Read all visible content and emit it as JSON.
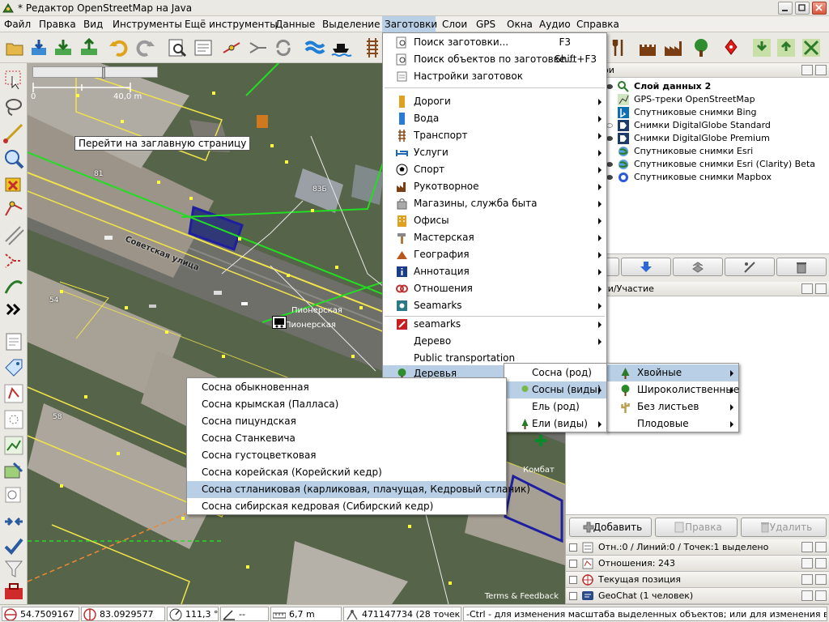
{
  "window": {
    "title": "* Редактор OpenStreetMap на Java"
  },
  "menubar": [
    "Файл",
    "Правка",
    "Вид",
    "Инструменты",
    "Ещё инструменты",
    "Данные",
    "Выделение",
    "Заготовки",
    "Слои",
    "GPS",
    "Окна",
    "Аудио",
    "Справка"
  ],
  "map": {
    "scale_start": "0",
    "scale_end": "40,0 m",
    "tooltip": "Перейти на заглавную страницу",
    "street": "Советская улица",
    "stop_label_1": "Пионерская",
    "stop_label_2": "Пионерская",
    "house_1": "54",
    "house_2": "83Б",
    "house_3": "81",
    "house_4": "58",
    "place_1": "Комбат",
    "terms": "Terms & Feedback"
  },
  "presets_menu": {
    "items": [
      {
        "label": "Поиск заготовки...",
        "shortcut": "F3"
      },
      {
        "label": "Поиск объектов по заготовке...",
        "shortcut": "Shift+F3"
      },
      {
        "label": "Настройки заготовок",
        "shortcut": ""
      },
      {
        "label": "Дороги",
        "shortcut": ""
      },
      {
        "label": "Вода",
        "shortcut": ""
      },
      {
        "label": "Транспорт",
        "shortcut": ""
      },
      {
        "label": "Услуги",
        "shortcut": ""
      },
      {
        "label": "Спорт",
        "shortcut": ""
      },
      {
        "label": "Рукотворное",
        "shortcut": ""
      },
      {
        "label": "Магазины, служба быта",
        "shortcut": ""
      },
      {
        "label": "Офисы",
        "shortcut": ""
      },
      {
        "label": "Мастерская",
        "shortcut": ""
      },
      {
        "label": "География",
        "shortcut": ""
      },
      {
        "label": "Аннотация",
        "shortcut": ""
      },
      {
        "label": "Отношения",
        "shortcut": ""
      },
      {
        "label": "Seamarks",
        "shortcut": ""
      },
      {
        "label": "seamarks",
        "shortcut": ""
      },
      {
        "label": "Дерево",
        "shortcut": ""
      },
      {
        "label": "Public transportation",
        "shortcut": ""
      },
      {
        "label": "Деревья",
        "shortcut": ""
      }
    ]
  },
  "trees_menu": {
    "items": [
      "Хвойные",
      "Широколиственные",
      "Без листьев",
      "Плодовые"
    ]
  },
  "conifer_menu": {
    "items": [
      "Сосна (род)",
      "Сосны (виды)",
      "Ель (род)",
      "Ели (виды)"
    ]
  },
  "pine_menu": {
    "items": [
      "Сосна обыкновенная",
      "Сосна крымская (Палласа)",
      "Сосна пицундская",
      "Сосна Станкевича",
      "Сосна густоцветковая",
      "Сосна корейская (Корейский кедр)",
      "Сосна стланиковая (карликовая, плачущая, Кедровый стланик)",
      "Сосна сибирская кедровая (Сибирский кедр)"
    ]
  },
  "layers_panel": {
    "header": "ои",
    "layers": [
      "Слой данных 2",
      "GPS-треки OpenStreetMap",
      "Спутниковые снимки Bing",
      "Снимки DigitalGlobe Standard",
      "Снимки DigitalGlobe Premium",
      "Спутниковые снимки Esri",
      "Спутниковые снимки Esri (Clarity) Beta",
      "Спутниковые снимки Mapbox"
    ]
  },
  "tags_panel": {
    "header": "ги/Участие",
    "add": "Добавить",
    "edit": "Правка",
    "delete": "Удалить"
  },
  "collapsed_panels": [
    "Отн.:0 / Линий:0 / Точек:1 выделено",
    "Отношения: 243",
    "Текущая позиция",
    "GeoChat (1 человек)"
  ],
  "statusbar": {
    "lat": "54.7509167",
    "lon": "83.0929577",
    "heading": "111,3 °",
    "angle": "--",
    "distance": "6,7 m",
    "node": "471147734 (28 точек)",
    "help": "-Ctrl - для изменения масштаба выделенных объектов; или для изменения выделения"
  },
  "colors": {
    "accent": "#b8cfe5",
    "osm_yellow": "#ffff00",
    "osm_green": "#00ff00",
    "building_blue": "#1e1e9e"
  }
}
